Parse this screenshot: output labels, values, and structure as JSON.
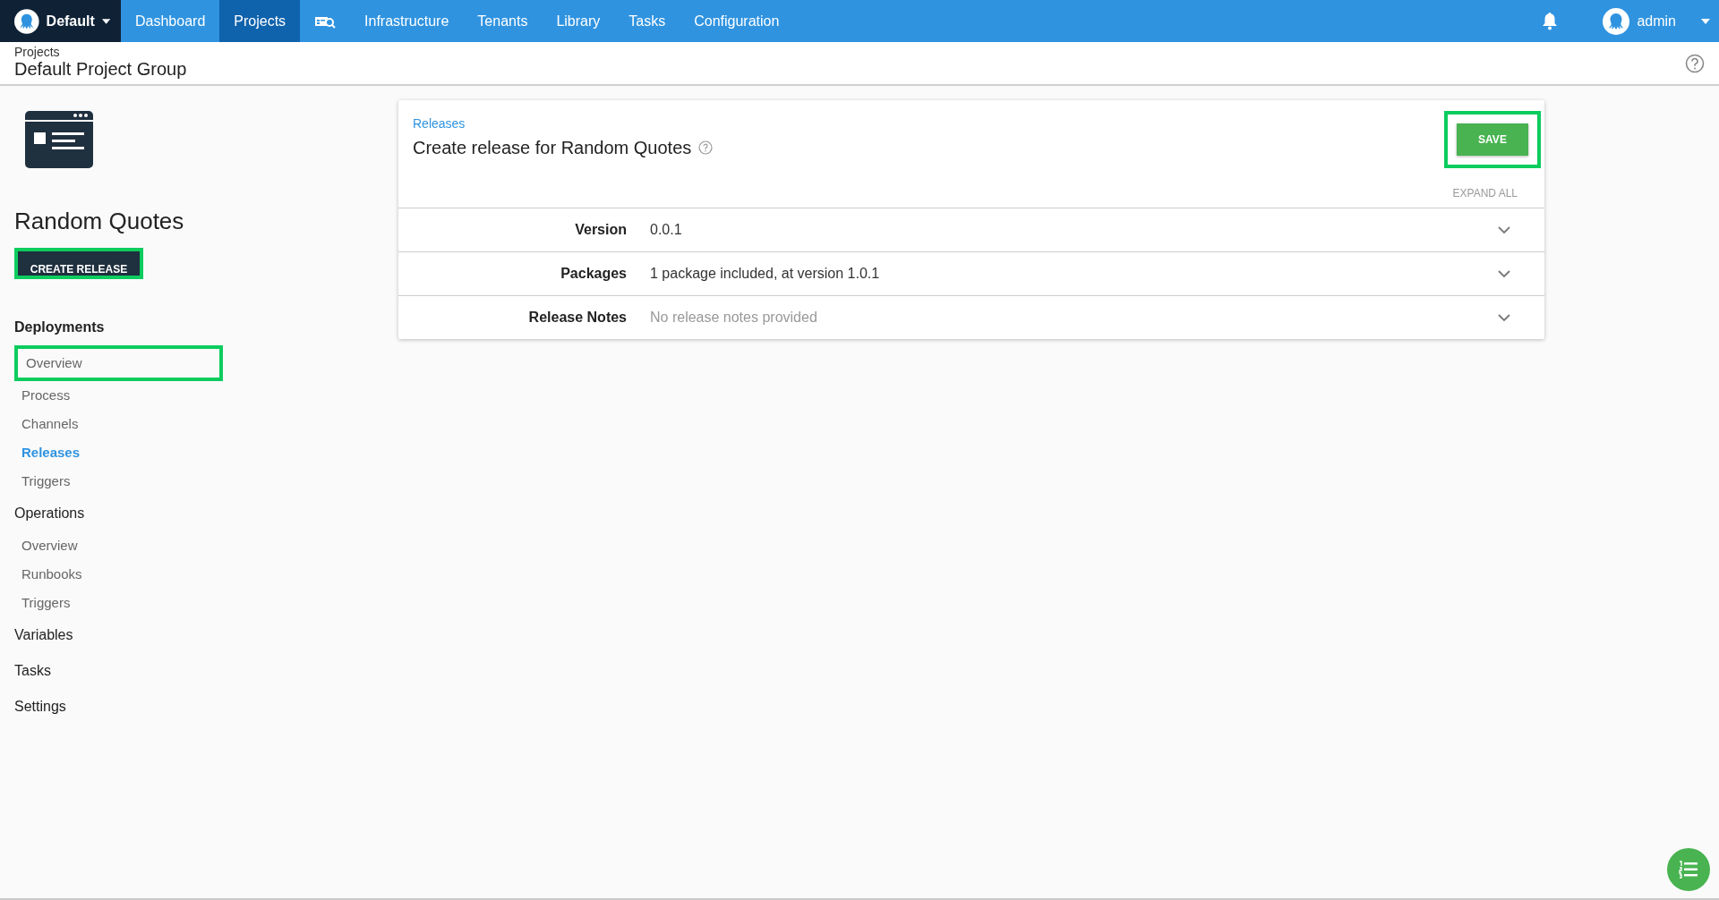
{
  "top_nav": {
    "space": "Default",
    "items": [
      {
        "label": "Dashboard",
        "kind": "text",
        "selected": false
      },
      {
        "label": "Projects",
        "kind": "text",
        "selected": true
      },
      {
        "kind": "icon",
        "selected": false
      },
      {
        "label": "Infrastructure",
        "kind": "text",
        "selected": false
      },
      {
        "label": "Tenants",
        "kind": "text",
        "selected": false
      },
      {
        "label": "Library",
        "kind": "text",
        "selected": false
      },
      {
        "label": "Tasks",
        "kind": "text",
        "selected": false
      },
      {
        "label": "Configuration",
        "kind": "text",
        "selected": false
      }
    ],
    "user": "admin"
  },
  "breadcrumb": {
    "parent": "Projects",
    "title": "Default Project Group"
  },
  "sidebar": {
    "project": "Random Quotes",
    "create_button": {
      "label": "CREATE RELEASE",
      "highlighted": true
    },
    "sections": [
      {
        "title": "Deployments",
        "selected": true,
        "items": [
          {
            "label": "Overview",
            "selected": false,
            "highlighted": true
          },
          {
            "label": "Process",
            "selected": false,
            "highlighted": false
          },
          {
            "label": "Channels",
            "selected": false,
            "highlighted": false
          },
          {
            "label": "Releases",
            "selected": true,
            "highlighted": false
          },
          {
            "label": "Triggers",
            "selected": false,
            "highlighted": false
          }
        ]
      },
      {
        "title": "Operations",
        "selected": false,
        "items": [
          {
            "label": "Overview",
            "selected": false,
            "highlighted": false
          },
          {
            "label": "Runbooks",
            "selected": false,
            "highlighted": false
          },
          {
            "label": "Triggers",
            "selected": false,
            "highlighted": false
          }
        ]
      },
      {
        "title": "Variables",
        "selected": false
      },
      {
        "title": "Tasks",
        "selected": false
      },
      {
        "title": "Settings",
        "selected": false
      }
    ]
  },
  "card": {
    "breadcrumb": "Releases",
    "title": "Create release for Random Quotes",
    "save_button": {
      "label": "SAVE",
      "highlighted": true
    },
    "expand_all": "EXPAND ALL",
    "rows": [
      {
        "label": "Version",
        "value": "0.0.1",
        "placeholder": false
      },
      {
        "label": "Packages",
        "value": "1 package included, at version 1.0.1",
        "placeholder": false
      },
      {
        "label": "Release Notes",
        "value": "No release notes provided",
        "placeholder": true
      }
    ]
  }
}
